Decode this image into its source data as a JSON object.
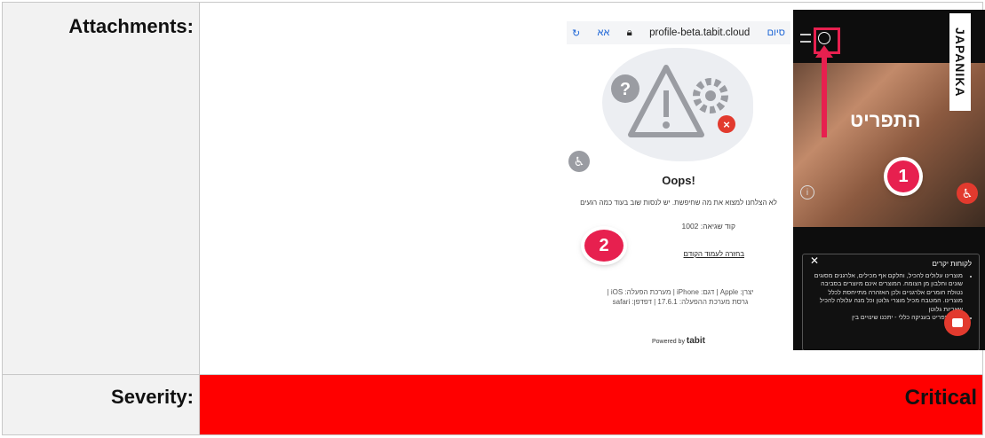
{
  "labels": {
    "attachments": "Attachments:",
    "severity": "Severity:"
  },
  "severity": {
    "value": "Critical",
    "color": "#ff0000"
  },
  "shot1": {
    "browser_left": "סיום",
    "browser_font": "אא",
    "url": "profile-beta.tabit.cloud",
    "oops": "Oops!",
    "message": "לא הצלחנו למצוא את מה שחיפשת. יש לנסות שוב בעוד כמה רגעים",
    "error_code": "קוד שגיאה: 1002",
    "back_link": "בחזרה לעמוד הקודם",
    "meta_line1": "יצרן: Apple | דגם: iPhone | מערכת הפעלה: iOS |",
    "meta_line2": "גרסת מערכת ההפעלה: 17.6.1 | דפדפן: safari",
    "powered_label": "Powered by",
    "powered_brand": "tabit",
    "marker": "2"
  },
  "shot2": {
    "brand": "JAPANIKA",
    "title": "התפריט",
    "marker": "1",
    "notice_title": "לקוחות יקרים",
    "notice_item1": "מוצרינו עלולים להכיל, וחלקם אף מכילים, אלרגנים מסוגים שונים וחלבון מן הצומח. המוצרים אינם מיוצרים בסביבה נטולת חומרים אלרגניים ולכן האזהרה מתייחסת לכלל מוצרינו. המטבח מכיל מוצרי גלוטן וכל מנה עלולה להכיל שאריות גלוטן",
    "notice_item2": "להלן תפריט בעניקה כללי - יתכנו שינויים בין",
    "accent": "#e7204f"
  }
}
